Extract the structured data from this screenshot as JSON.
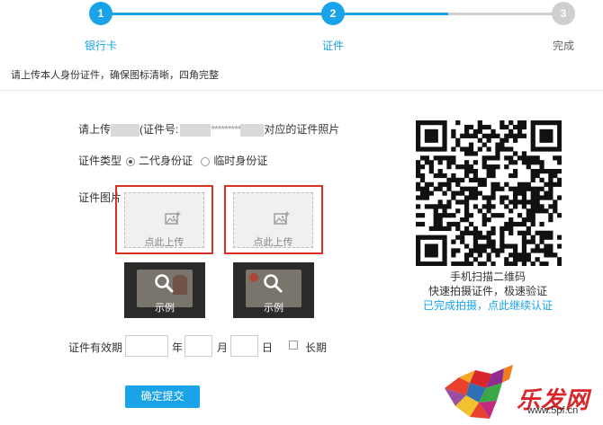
{
  "steps": [
    {
      "num": "1",
      "label": "银行卡",
      "state": "done"
    },
    {
      "num": "2",
      "label": "证件",
      "state": "active"
    },
    {
      "num": "3",
      "label": "完成",
      "state": "todo"
    }
  ],
  "colors": {
    "accent": "#1aa3e8",
    "inactive": "#cfcfcf",
    "highlight": "#d93025",
    "logo": "#d9262a"
  },
  "hint": "请上传本人身份证件，确保图标清晰，四角完整",
  "form": {
    "prompt_prefix": "请上传",
    "prompt_mid": "(证件号:",
    "prompt_masked": "*********",
    "prompt_suffix": "对应的证件照片",
    "type_label": "证件类型",
    "type_options": [
      {
        "label": "二代身份证",
        "selected": true
      },
      {
        "label": "临时身份证",
        "selected": false
      }
    ],
    "image_label": "证件图片",
    "upload_label": "点此上传",
    "sample_label": "示例",
    "validity_label": "证件有效期",
    "year_unit": "年",
    "month_unit": "月",
    "day_unit": "日",
    "long_term_label": "长期",
    "submit_label": "确定提交"
  },
  "qr": {
    "line1": "手机扫描二维码",
    "line2": "快速拍摄证件，极速验证",
    "link": "已完成拍摄，点此继续认证"
  },
  "watermark": {
    "brand": "乐发网",
    "url": "www.5pf.cn"
  }
}
